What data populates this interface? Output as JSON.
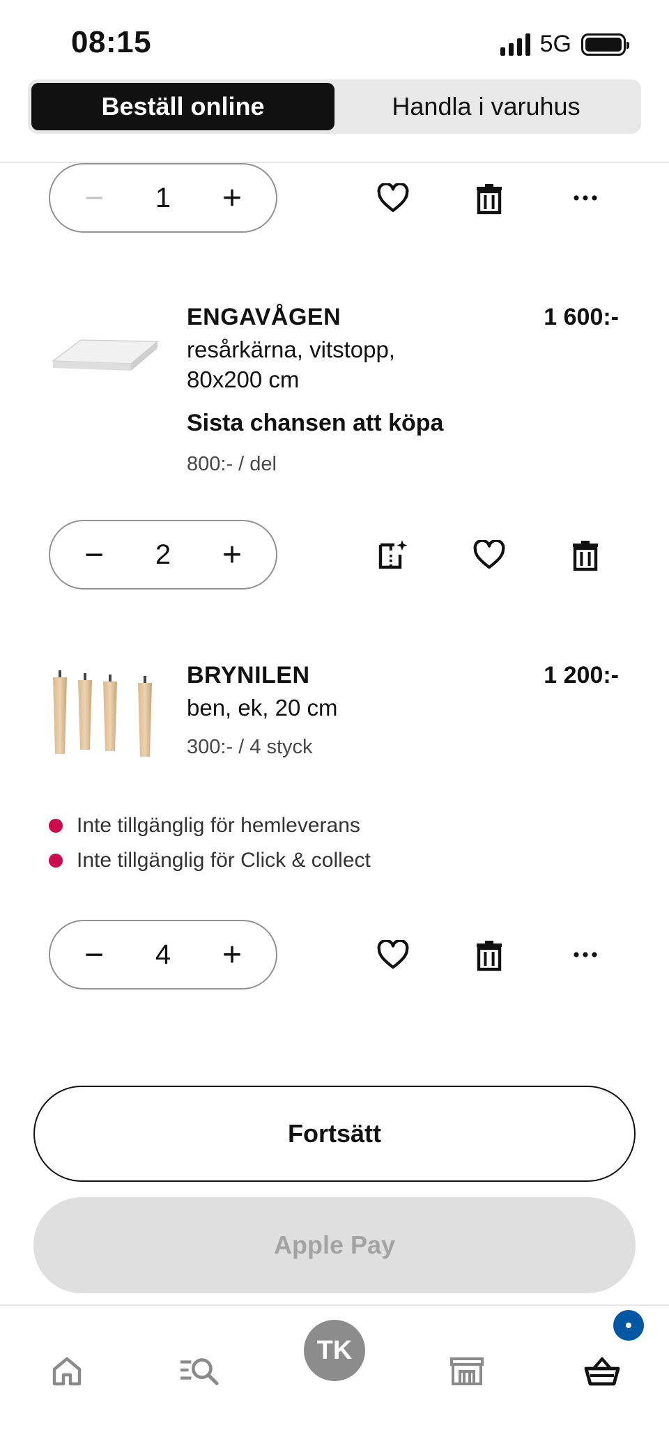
{
  "status_bar": {
    "time": "08:15",
    "network": "5G"
  },
  "tabs": [
    {
      "label": "Beställ online",
      "active": true
    },
    {
      "label": "Handla i varuhus",
      "active": false
    }
  ],
  "items": [
    {
      "quantity": "1",
      "actions": [
        "favorite-icon",
        "trash-icon",
        "more-icon"
      ]
    },
    {
      "name": "ENGAVÅGEN",
      "price": "1 600:-",
      "desc_line1": "resårkärna, vitstopp,",
      "desc_line2": "80x200 cm",
      "note": "Sista chansen att köpa",
      "unit_price": "800:- / del",
      "quantity": "2",
      "actions": [
        "room-planner-icon",
        "favorite-icon",
        "trash-icon"
      ]
    },
    {
      "name": "BRYNILEN",
      "price": "1 200:-",
      "desc_line1": "ben, ek, 20 cm",
      "unit_price": "300:- / 4 styck",
      "availability": [
        "Inte tillgänglig för hemleverans",
        "Inte tillgänglig för Click & collect"
      ],
      "quantity": "4",
      "actions": [
        "favorite-icon",
        "trash-icon",
        "more-icon"
      ]
    }
  ],
  "buttons": {
    "continue": "Fortsätt",
    "apple_pay": "Apple Pay"
  },
  "nav": {
    "avatar_initials": "TK"
  },
  "colors": {
    "accent": "#111111",
    "badge": "#0058a3",
    "unavailable_dot": "#cc0a4d"
  }
}
